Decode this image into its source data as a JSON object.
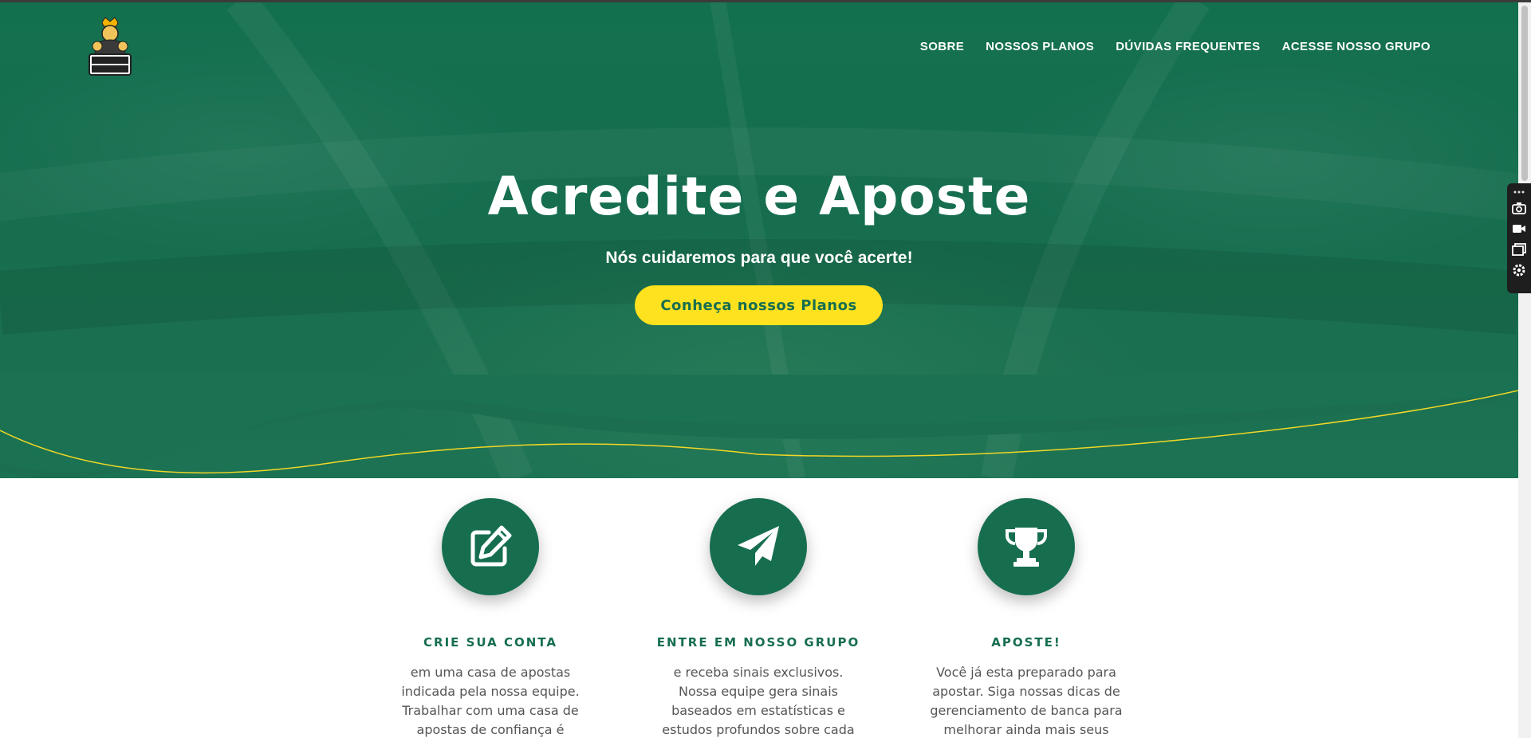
{
  "header": {
    "logo_alt": "Reis Tips",
    "nav": [
      {
        "label": "SOBRE"
      },
      {
        "label": "NOSSOS PLANOS"
      },
      {
        "label": "DÚVIDAS FREQUENTES"
      },
      {
        "label": "ACESSE NOSSO GRUPO"
      }
    ]
  },
  "hero": {
    "title": "Acredite e Aposte",
    "subtitle": "Nós cuidaremos para que você acerte!",
    "cta_label": "Conheça nossos Planos"
  },
  "features": [
    {
      "icon": "edit-icon",
      "title": "CRIE SUA CONTA",
      "text": "em uma casa de apostas indicada pela nossa equipe. Trabalhar com uma casa de apostas de confiança é"
    },
    {
      "icon": "paper-plane-icon",
      "title": "ENTRE EM NOSSO GRUPO",
      "text": "e receba sinais exclusivos. Nossa equipe gera sinais baseados em estatísticas e estudos profundos sobre cada mercado."
    },
    {
      "icon": "trophy-icon",
      "title": "APOSTE!",
      "text": "Você já esta preparado para apostar. Siga nossas dicas de gerenciamento de banca para melhorar ainda mais seus lucros!"
    }
  ],
  "colors": {
    "brand_green": "#166e4f",
    "accent_yellow": "#ffe21f",
    "text_gray": "#555555"
  },
  "side_toolbar": {
    "icons": [
      "camera-icon",
      "video-icon",
      "windows-icon",
      "gear-icon"
    ]
  }
}
